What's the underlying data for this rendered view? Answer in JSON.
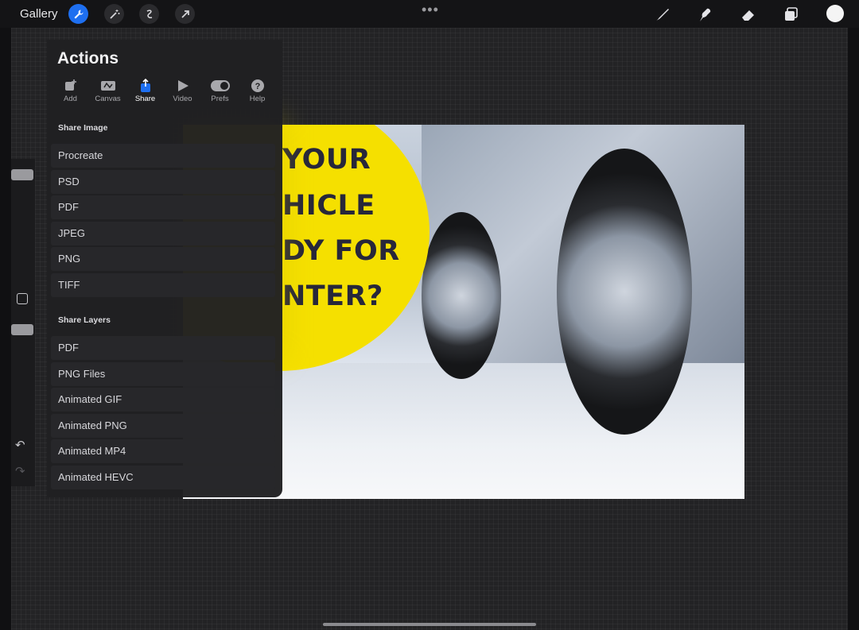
{
  "topbar": {
    "gallery_label": "Gallery",
    "icons": [
      "wrench-icon",
      "magic-wand-icon",
      "selection-icon",
      "transform-arrow-icon"
    ],
    "more_glyph": "•••",
    "tools": [
      "brush-icon",
      "smudge-icon",
      "eraser-icon",
      "layers-icon"
    ],
    "current_color": "#f4f4f4"
  },
  "sidebar": {
    "undo_glyph": "↶",
    "redo_glyph": "↷"
  },
  "artwork": {
    "headline_lines": [
      "YOUR",
      "HICLE",
      "DY FOR",
      "NTER?"
    ],
    "circle_color": "#f5e000",
    "text_color": "#27273a"
  },
  "actions": {
    "title": "Actions",
    "tabs": [
      {
        "label": "Add",
        "icon": "add-icon"
      },
      {
        "label": "Canvas",
        "icon": "canvas-icon"
      },
      {
        "label": "Share",
        "icon": "share-icon",
        "active": true
      },
      {
        "label": "Video",
        "icon": "video-icon"
      },
      {
        "label": "Prefs",
        "icon": "prefs-toggle-icon"
      },
      {
        "label": "Help",
        "icon": "help-icon"
      }
    ],
    "share_image_heading": "Share Image",
    "share_image_items": [
      "Procreate",
      "PSD",
      "PDF",
      "JPEG",
      "PNG",
      "TIFF"
    ],
    "share_layers_heading": "Share Layers",
    "share_layers_items": [
      "PDF",
      "PNG Files",
      "Animated GIF",
      "Animated PNG",
      "Animated MP4",
      "Animated HEVC"
    ],
    "accent_color": "#1e6ff0"
  }
}
